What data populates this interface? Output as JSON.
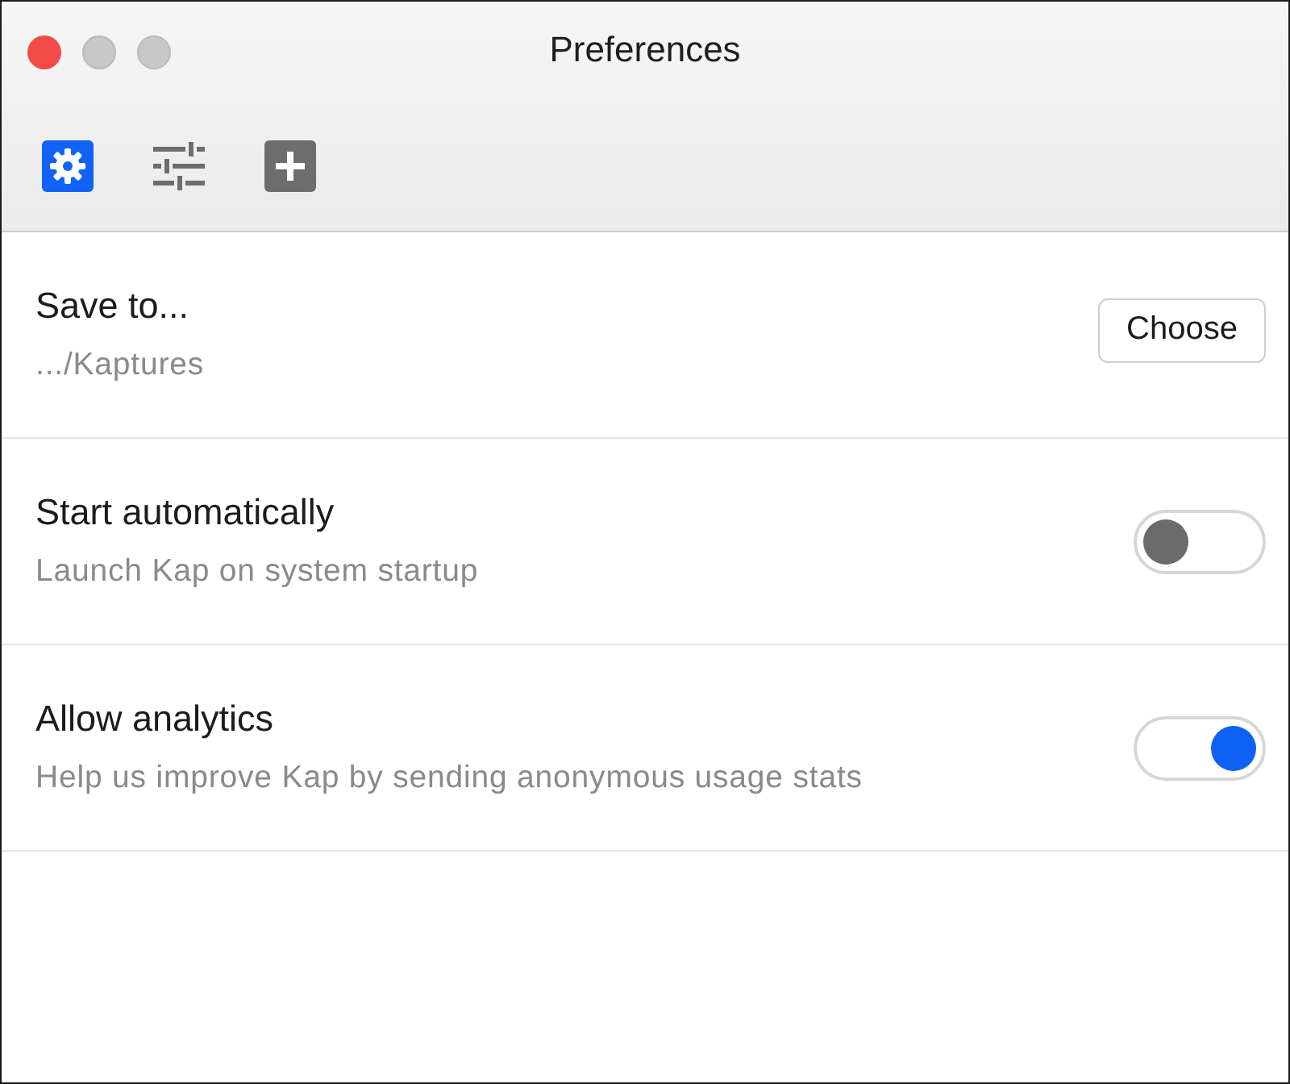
{
  "window": {
    "title": "Preferences",
    "controls": [
      {
        "kind": "close",
        "disabled": false
      },
      {
        "kind": "minimize",
        "disabled": true
      },
      {
        "kind": "zoom",
        "disabled": true
      }
    ]
  },
  "tabs": [
    {
      "kind": "gear",
      "selected": true
    },
    {
      "kind": "sliders",
      "selected": false
    },
    {
      "kind": "plus",
      "selected": false
    }
  ],
  "settings": [
    {
      "kind": "button",
      "title": "Save to...",
      "subtitle": ".../Kaptures",
      "button": "Choose"
    },
    {
      "kind": "toggle",
      "title": "Start automatically",
      "subtitle": "Launch Kap on system startup",
      "on": false
    },
    {
      "kind": "toggle",
      "title": "Allow analytics",
      "subtitle": "Help us improve Kap by sending anonymous usage stats",
      "on": true
    }
  ]
}
